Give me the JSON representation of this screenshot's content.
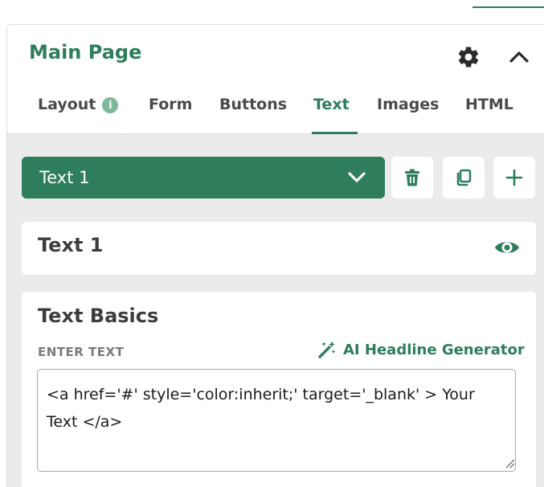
{
  "panel": {
    "title": "Main Page"
  },
  "tabs": [
    {
      "label": "Layout",
      "badge": "i"
    },
    {
      "label": "Form"
    },
    {
      "label": "Buttons"
    },
    {
      "label": "Text"
    },
    {
      "label": "Images"
    },
    {
      "label": "HTML"
    }
  ],
  "element_selector": {
    "value": "Text 1"
  },
  "element_card": {
    "name": "Text 1"
  },
  "text_basics": {
    "title": "Text Basics",
    "field_label": "ENTER TEXT",
    "ai_link": "AI Headline Generator",
    "value": "<a href='#' style='color:inherit;' target='_blank' > Your Text </a>"
  },
  "colors": {
    "accent": "#2e7d5b",
    "panel_bg": "#ebebeb"
  },
  "icons": [
    "gear-icon",
    "chevron-up-icon",
    "info-icon",
    "chevron-down-icon",
    "trash-icon",
    "duplicate-icon",
    "plus-icon",
    "eye-icon",
    "magic-wand-icon",
    "resize-handle-icon"
  ]
}
